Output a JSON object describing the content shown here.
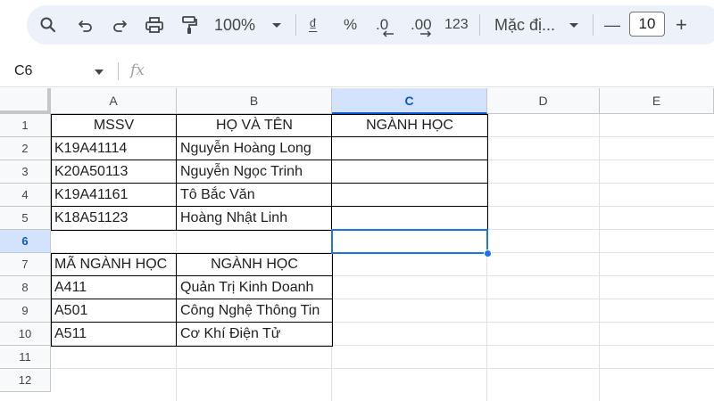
{
  "toolbar": {
    "zoom": "100%",
    "currency_symbol": "₫",
    "percent_symbol": "%",
    "decrease_decimal": ".0",
    "increase_decimal": ".00",
    "number_format": "123",
    "font_name": "Mặc đị...",
    "font_size": "10",
    "minus": "—",
    "plus": "+"
  },
  "formula_bar": {
    "cell_ref": "C6",
    "fx_label": "fx"
  },
  "columns": [
    "A",
    "B",
    "C",
    "D",
    "E"
  ],
  "selected_column": "C",
  "rows": [
    "1",
    "2",
    "3",
    "4",
    "5",
    "6",
    "7",
    "8",
    "9",
    "10",
    "11",
    "12"
  ],
  "selected_row": "6",
  "cells": {
    "r1": {
      "a": "MSSV",
      "b": "HỌ VÀ TÊN",
      "c": "NGÀNH HỌC"
    },
    "r2": {
      "a": "K19A41114",
      "b": "Nguyễn Hoàng Long"
    },
    "r3": {
      "a": "K20A50113",
      "b": "Nguyễn Ngọc Trinh"
    },
    "r4": {
      "a": "K19A41161",
      "b": "Tô Bắc Văn"
    },
    "r5": {
      "a": "K18A51123",
      "b": "Hoàng Nhật Linh"
    },
    "r7": {
      "a": "MÃ NGÀNH HỌC",
      "b": "NGÀNH HỌC"
    },
    "r8": {
      "a": "A411",
      "b": "Quản Trị Kinh Doanh"
    },
    "r9": {
      "a": "A501",
      "b": "Công Nghệ Thông Tin"
    },
    "r10": {
      "a": "A511",
      "b": "Cơ Khí Điện Tử"
    }
  },
  "icons": [
    "search-icon",
    "undo-icon",
    "redo-icon",
    "print-icon",
    "paint-format-icon",
    "zoom-dropdown-icon",
    "font-dropdown-icon",
    "namebox-dropdown-icon"
  ]
}
